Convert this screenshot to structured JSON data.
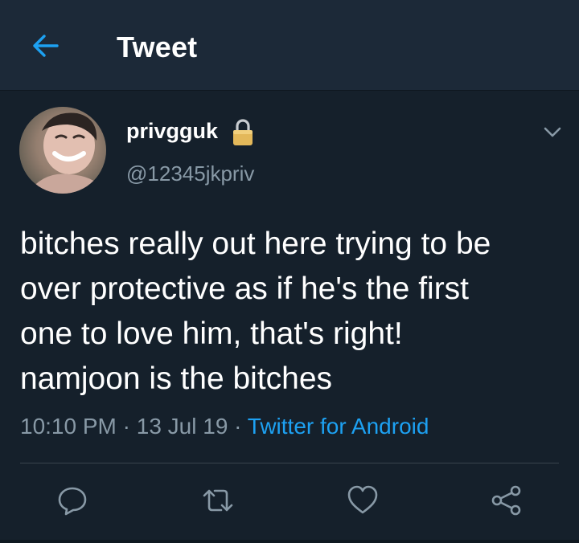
{
  "header": {
    "back_icon": "arrow-left-icon",
    "title": "Tweet"
  },
  "tweet": {
    "author": {
      "display_name": "privgguk",
      "handle": "@12345jkpriv",
      "protected_icon": "lock-icon"
    },
    "text": "bitches really out here trying to be\nover protective as if he's the first\none to love him, that's right!\nnamjoon is the bitches",
    "time": "10:10 PM",
    "separator": "·",
    "date": "13 Jul 19",
    "source": "Twitter for Android"
  },
  "actions": [
    {
      "icon": "reply-icon"
    },
    {
      "icon": "retweet-icon"
    },
    {
      "icon": "heart-icon"
    },
    {
      "icon": "share-icon"
    }
  ],
  "colors": {
    "background": "#15202b",
    "header": "#1c2938",
    "accent": "#1da1f2",
    "secondary_text": "#8899a6",
    "lock": "#e3b85a"
  }
}
